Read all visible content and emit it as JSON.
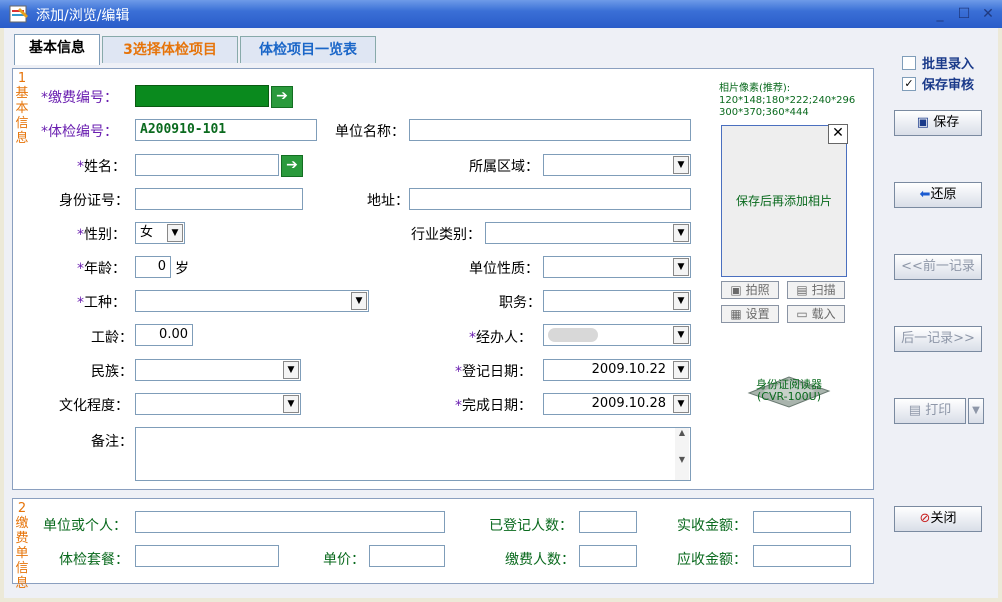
{
  "window": {
    "title": "添加/浏览/编辑",
    "min": "_",
    "max": "☐",
    "close": "✕"
  },
  "tabs": [
    {
      "label": "基本信息"
    },
    {
      "label": "3选择体检项目"
    },
    {
      "label": "体检项目一览表"
    }
  ],
  "section1": {
    "label": "1基本信息"
  },
  "section2": {
    "label": "2缴费单信息"
  },
  "form": {
    "fee_no": {
      "label": "缴费编号：",
      "value": ""
    },
    "exam_no": {
      "label": "体检编号：",
      "value": "A200910-101"
    },
    "unit_name": {
      "label": "单位名称：",
      "value": ""
    },
    "name": {
      "label": "姓名：",
      "value": ""
    },
    "area": {
      "label": "所属区域：",
      "value": ""
    },
    "id_no": {
      "label": "身份证号：",
      "value": ""
    },
    "address": {
      "label": "地址：",
      "value": ""
    },
    "gender": {
      "label": "性别：",
      "value": "女"
    },
    "industry": {
      "label": "行业类别：",
      "value": ""
    },
    "age": {
      "label": "年龄：",
      "value": "0",
      "unit": "岁"
    },
    "unit_type": {
      "label": "单位性质：",
      "value": ""
    },
    "job": {
      "label": "工种：",
      "value": ""
    },
    "position": {
      "label": "职务：",
      "value": ""
    },
    "seniority": {
      "label": "工龄：",
      "value": "0.00"
    },
    "handler": {
      "label": "经办人：",
      "value": ""
    },
    "ethnic": {
      "label": "民族：",
      "value": ""
    },
    "reg_date": {
      "label": "登记日期：",
      "value": "2009.10.22"
    },
    "education": {
      "label": "文化程度：",
      "value": ""
    },
    "done_date": {
      "label": "完成日期：",
      "value": "2009.10.28"
    },
    "remark": {
      "label": "备注：",
      "value": ""
    }
  },
  "photo": {
    "hint_title": "相片像素(推荐):",
    "hint_line1": "120*148;180*222;240*296",
    "hint_line2": "300*370;360*444",
    "placeholder": "保存后再添加相片",
    "btn_shoot": "拍照",
    "btn_scan": "扫描",
    "btn_set": "设置",
    "btn_load": "载入",
    "reader_line1": "身份证阅读器",
    "reader_line2": "(CVR-100U)"
  },
  "fee": {
    "unit_or_person": {
      "label": "单位或个人：",
      "value": ""
    },
    "registered": {
      "label": "已登记人数：",
      "value": ""
    },
    "received": {
      "label": "实收金额：",
      "value": ""
    },
    "package": {
      "label": "体检套餐：",
      "value": ""
    },
    "price": {
      "label": "单价：",
      "value": ""
    },
    "payers": {
      "label": "缴费人数：",
      "value": ""
    },
    "receivable": {
      "label": "应收金额：",
      "value": ""
    }
  },
  "right": {
    "batch": "批里录入",
    "save_review": "保存审核",
    "save_review_checked": "✓",
    "save": "保存",
    "restore": "还原",
    "prev": "<<前一记录",
    "next": "后一记录>>",
    "print": "打印",
    "print_arrow": "▼",
    "close": "关闭"
  },
  "colors": {
    "accent": "#2a5cc9",
    "fee_field": "#0a8a1e",
    "star": "#6a1fb0",
    "section": "#e6740a"
  }
}
